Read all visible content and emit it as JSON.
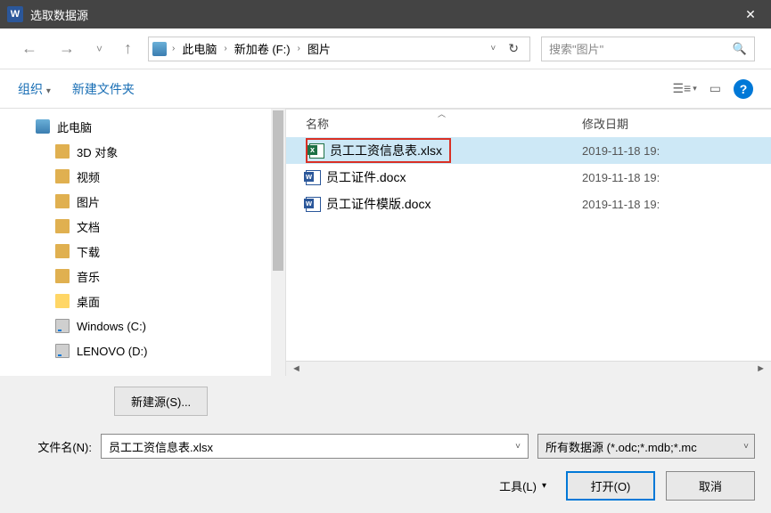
{
  "window": {
    "title": "选取数据源"
  },
  "nav": {
    "breadcrumb": [
      "此电脑",
      "新加卷 (F:)",
      "图片"
    ],
    "search_placeholder": "搜索\"图片\""
  },
  "toolbar": {
    "organize": "组织",
    "new_folder": "新建文件夹"
  },
  "tree": [
    {
      "label": "此电脑",
      "indent": "top",
      "icon": "pc"
    },
    {
      "label": "3D 对象",
      "indent": "child",
      "icon": "folder-tan"
    },
    {
      "label": "视频",
      "indent": "child",
      "icon": "folder-tan"
    },
    {
      "label": "图片",
      "indent": "child",
      "icon": "folder-tan"
    },
    {
      "label": "文档",
      "indent": "child",
      "icon": "folder-tan"
    },
    {
      "label": "下载",
      "indent": "child",
      "icon": "folder-tan"
    },
    {
      "label": "音乐",
      "indent": "child",
      "icon": "folder-tan"
    },
    {
      "label": "桌面",
      "indent": "child",
      "icon": "folder-yellow"
    },
    {
      "label": "Windows (C:)",
      "indent": "child",
      "icon": "drive"
    },
    {
      "label": "LENOVO (D:)",
      "indent": "child",
      "icon": "drive"
    }
  ],
  "columns": {
    "name": "名称",
    "date": "修改日期"
  },
  "files": [
    {
      "name": "员工工资信息表.xlsx",
      "date": "2019-11-18 19:",
      "type": "xlsx",
      "selected": true,
      "highlighted": true
    },
    {
      "name": "员工证件.docx",
      "date": "2019-11-18 19:",
      "type": "docx",
      "selected": false
    },
    {
      "name": "员工证件模版.docx",
      "date": "2019-11-18 19:",
      "type": "docx",
      "selected": false
    }
  ],
  "bottom": {
    "new_source": "新建源(S)...",
    "filename_label": "文件名(N):",
    "filename_value": "员工工资信息表.xlsx",
    "filetype": "所有数据源 (*.odc;*.mdb;*.mc",
    "tools": "工具(L)",
    "open": "打开(O)",
    "cancel": "取消"
  }
}
